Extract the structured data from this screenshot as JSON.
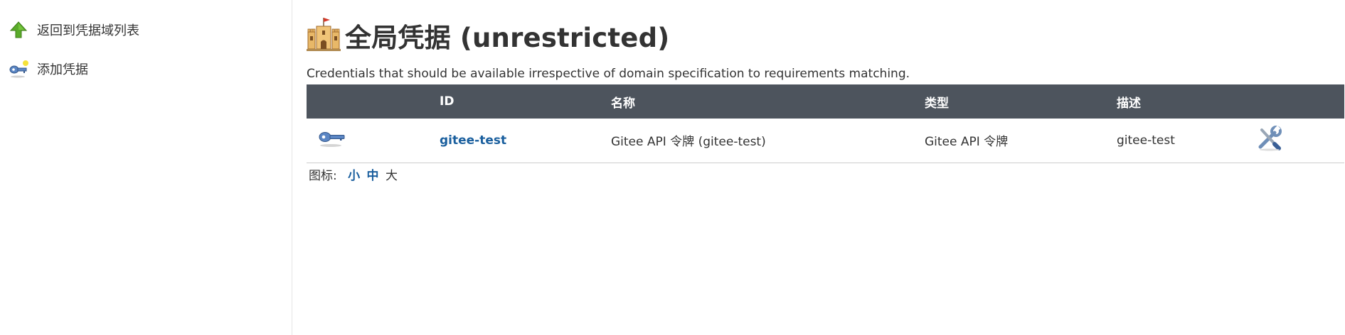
{
  "sidebar": {
    "items": [
      {
        "label": "返回到凭据域列表",
        "icon": "up-arrow-icon"
      },
      {
        "label": "添加凭据",
        "icon": "key-add-icon"
      }
    ]
  },
  "main": {
    "title": "全局凭据 (unrestricted)",
    "title_icon": "castle-icon",
    "description": "Credentials that should be available irrespective of domain specification to requirements matching.",
    "table": {
      "headers": [
        "",
        "ID",
        "名称",
        "类型",
        "描述",
        ""
      ],
      "rows": [
        {
          "icon": "key-icon",
          "id": "gitee-test",
          "name": "Gitee API 令牌 (gitee-test)",
          "type": "Gitee API 令牌",
          "description": "gitee-test",
          "action_icon": "configure-tools-icon"
        }
      ]
    },
    "icon_size": {
      "label": "图标:",
      "small": "小",
      "medium": "中",
      "large": "大"
    }
  },
  "colors": {
    "table_header_bg": "#4d545d",
    "link": "#1a5f9e",
    "text": "#333333"
  }
}
